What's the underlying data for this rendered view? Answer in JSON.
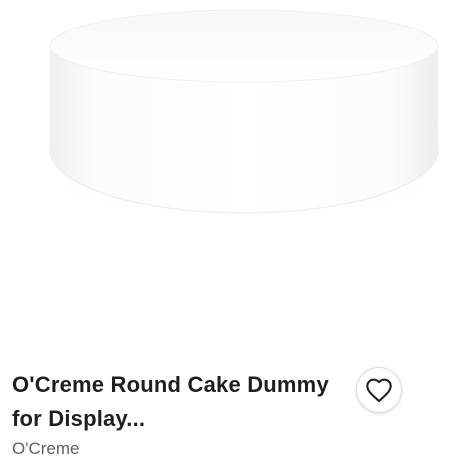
{
  "product": {
    "title": "O'Creme Round Cake Dummy for Display...",
    "brand": "O'Creme",
    "image_alt": "White round cake dummy",
    "favorite_icon": "heart-outline-icon"
  },
  "colors": {
    "title_text": "#1f1f1f",
    "brand_text": "#5f5f5f",
    "icon_stroke": "#1f1f1f",
    "button_border": "#dcdcdc"
  }
}
